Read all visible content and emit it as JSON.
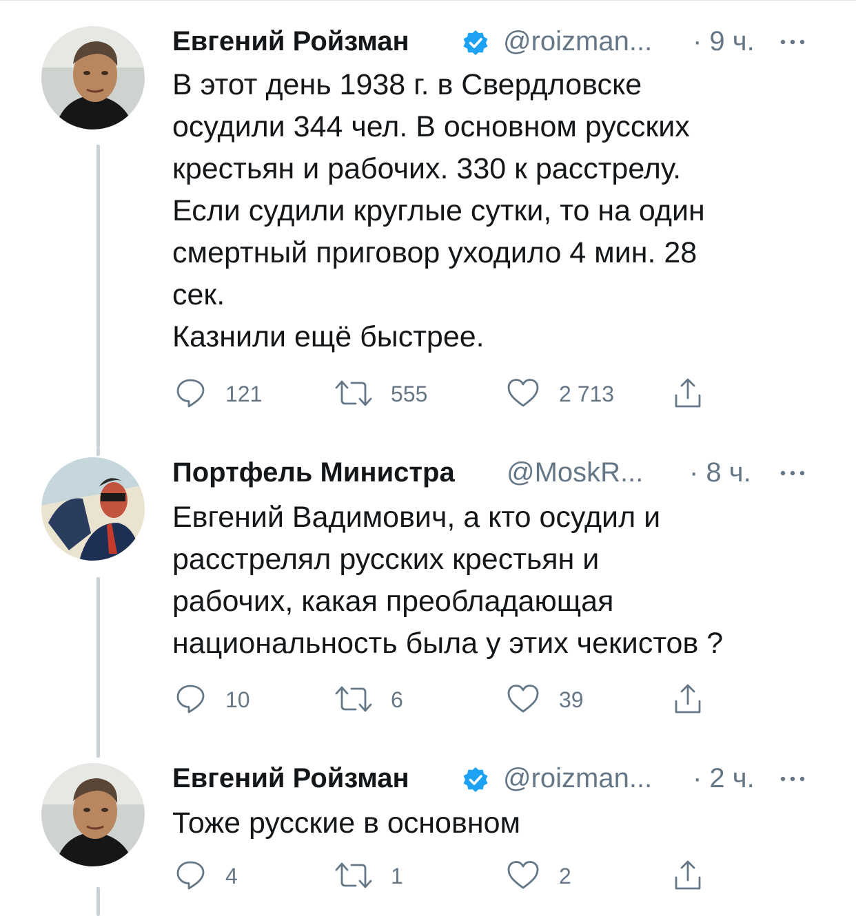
{
  "tweets": [
    {
      "name": "Евгений Ройзман",
      "verified": true,
      "handle": "@roizman...",
      "time": "· 9 ч.",
      "text": "В этот день 1938 г. в Свердловске\nосудили 344 чел. В основном русских\nкрестьян и рабочих. 330 к расстрелу.\nЕсли судили круглые сутки, то на один\nсмертный приговор уходило 4 мин. 28\nсек.\nКазнили ещё быстрее.",
      "replies": "121",
      "retweets": "555",
      "likes": "2 713"
    },
    {
      "name": "Портфель Министра",
      "verified": false,
      "handle": "@MoskR...",
      "time": "· 8 ч.",
      "text": "Евгений Вадимович, а кто осудил и\nрасстрелял русских крестьян и\nрабочих, какая преобладающая\nнациональность была у этих чекистов ?",
      "replies": "10",
      "retweets": "6",
      "likes": "39"
    },
    {
      "name": "Евгений Ройзман",
      "verified": true,
      "handle": "@roizman...",
      "time": "· 2 ч.",
      "text": "Тоже русские в основном",
      "replies": "4",
      "retweets": "1",
      "likes": "2"
    }
  ],
  "icons": {
    "reply": "reply-icon",
    "retweet": "retweet-icon",
    "like": "heart-icon",
    "share": "share-icon",
    "verified": "verified-badge-icon",
    "more": "more-icon"
  },
  "colors": {
    "text": "#14171a",
    "secondary": "#657786",
    "verified": "#1da1f2",
    "thread_line": "#c9d1d8"
  }
}
